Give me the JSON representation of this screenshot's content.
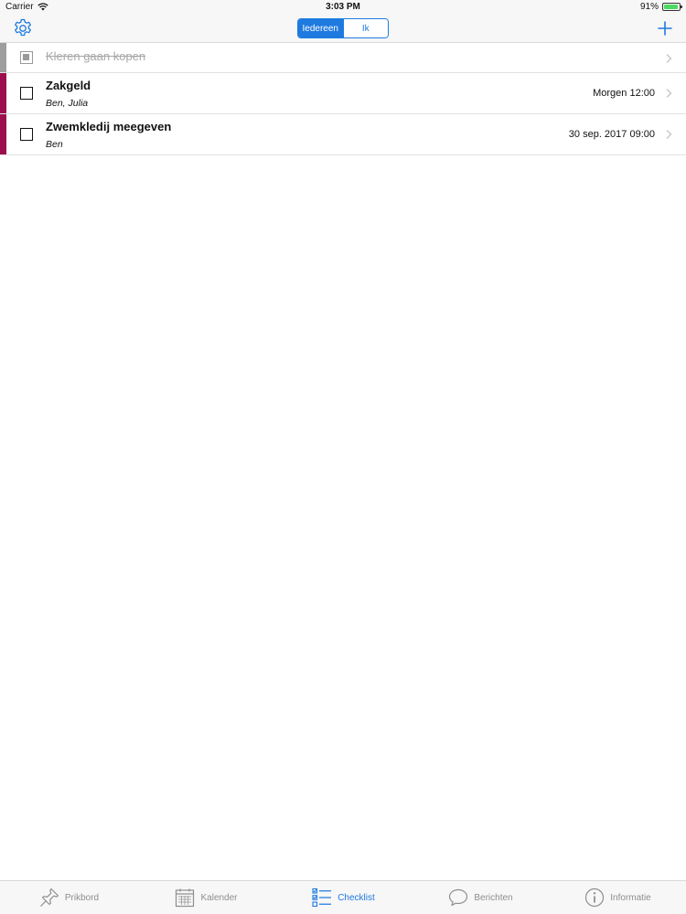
{
  "status_bar": {
    "carrier": "Carrier",
    "time": "3:03 PM",
    "battery": "91%",
    "battery_level": 0.91
  },
  "nav": {
    "segments": [
      "Iedereen",
      "Ik"
    ],
    "selected_segment": "Iedereen",
    "accent_color": "#1f7ae0"
  },
  "items": [
    {
      "title": "Kleren gaan kopen",
      "subtitle": "",
      "date": "",
      "done": true,
      "color": "#9e9e9e"
    },
    {
      "title": "Zakgeld",
      "subtitle": "Ben, Julia",
      "date": "Morgen 12:00",
      "done": false,
      "color": "#9b0f4e"
    },
    {
      "title": "Zwemkledij meegeven",
      "subtitle": "Ben",
      "date": "30 sep. 2017 09:00",
      "done": false,
      "color": "#9b0f4e"
    }
  ],
  "tabs": [
    {
      "label": "Prikbord",
      "icon": "pin-icon",
      "active": false
    },
    {
      "label": "Kalender",
      "icon": "calendar-icon",
      "active": false
    },
    {
      "label": "Checklist",
      "icon": "checklist-icon",
      "active": true
    },
    {
      "label": "Berichten",
      "icon": "chat-bubble-icon",
      "active": false
    },
    {
      "label": "Informatie",
      "icon": "info-icon",
      "active": false
    }
  ]
}
